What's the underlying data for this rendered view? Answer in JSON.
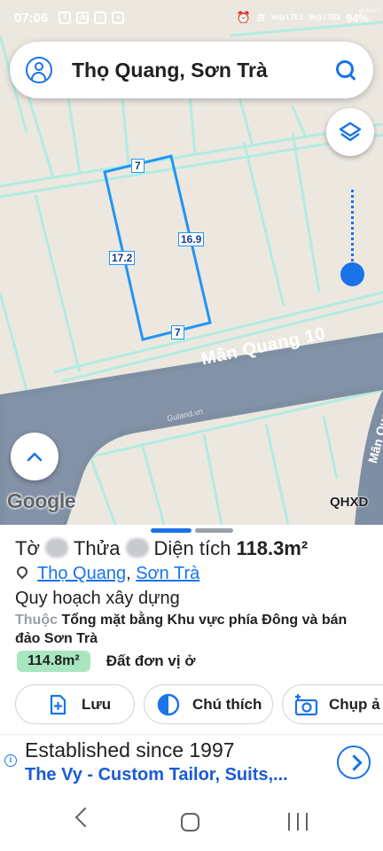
{
  "status_bar": {
    "time": "07:06",
    "notif_icons": [
      "zalo-icon",
      "gallery-icon",
      "check-icon",
      "image-icon"
    ],
    "network": [
      "Vo)) LTE1",
      "Vo)) LTE2"
    ],
    "battery": "94%"
  },
  "search": {
    "query": "Thọ Quang, Sơn Trà"
  },
  "map": {
    "parcel_labels": {
      "top": "7",
      "left": "17.2",
      "right": "16.9",
      "bottom": "7"
    },
    "street_name": "Mân Quang 10",
    "street_name_partial": "Mân Qua",
    "watermark": "Guland.vn",
    "google": "Google",
    "overlay_tag": "QHXD"
  },
  "sheet": {
    "title_prefix": "Tờ",
    "title_middle": "Thửa",
    "title_suffix": "Diện tích",
    "area": "118.3m²",
    "location": {
      "ward": "Thọ Quang",
      "separator": ",",
      "district": "Sơn Trà"
    },
    "plan_title": "Quy hoạch xây dựng",
    "plan_label": "Thuộc",
    "plan_desc": "Tổng mặt bằng Khu vực phía Đông và bán đảo Sơn Trà",
    "area_badge": "114.8m²",
    "area_type": "Đất đơn vị ở",
    "buttons": {
      "save": "Lưu",
      "legend": "Chú thích",
      "capture": "Chụp ả"
    }
  },
  "ad": {
    "headline": "Established since 1997",
    "subline": "The Vy - Custom Tailor, Suits,..."
  },
  "colors": {
    "accent": "#1a73e8",
    "badge": "#a8e6c0",
    "road": "#7f8fa3"
  }
}
